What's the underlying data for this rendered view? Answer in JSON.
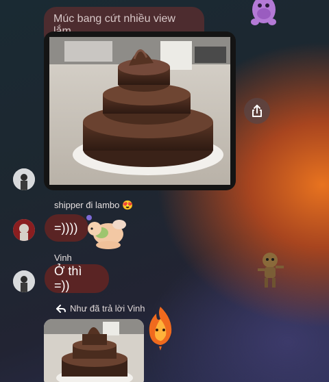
{
  "top_message": {
    "quoted_text": "Múc bang cứt nhiều view lắm"
  },
  "messages": [
    {
      "sender": "shipper đi lambo",
      "sender_emoji": "😍",
      "text": "=))))"
    },
    {
      "sender": "Vinh",
      "text": "Ở thì =))"
    }
  ],
  "reply_header": {
    "text": "Như đã trả lời Vinh"
  },
  "icons": {
    "share": "share-icon",
    "reply": "reply-arrow-icon"
  },
  "colors": {
    "bubble": "#5a2424",
    "quote_bubble": "#4d2c2f"
  }
}
